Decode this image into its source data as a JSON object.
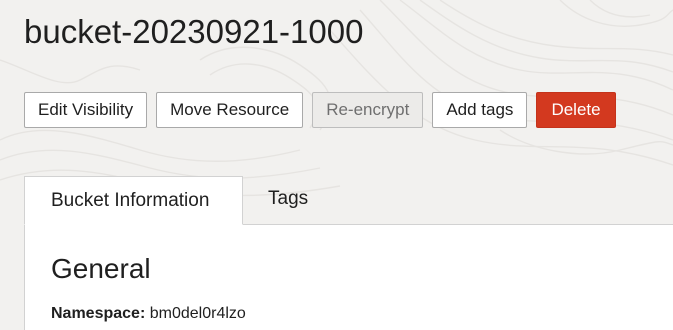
{
  "page": {
    "title": "bucket-20230921-1000"
  },
  "toolbar": {
    "edit_visibility_label": "Edit Visibility",
    "move_resource_label": "Move Resource",
    "reencrypt_label": "Re-encrypt",
    "add_tags_label": "Add tags",
    "delete_label": "Delete"
  },
  "tabs": [
    {
      "label": "Bucket Information",
      "active": true
    },
    {
      "label": "Tags",
      "active": false
    }
  ],
  "general": {
    "section_title": "General",
    "namespace_label": "Namespace:",
    "namespace_value": "bm0del0r4lzo"
  },
  "colors": {
    "background": "#f2f1ef",
    "danger": "#d3391f",
    "panel": "#ffffff"
  }
}
